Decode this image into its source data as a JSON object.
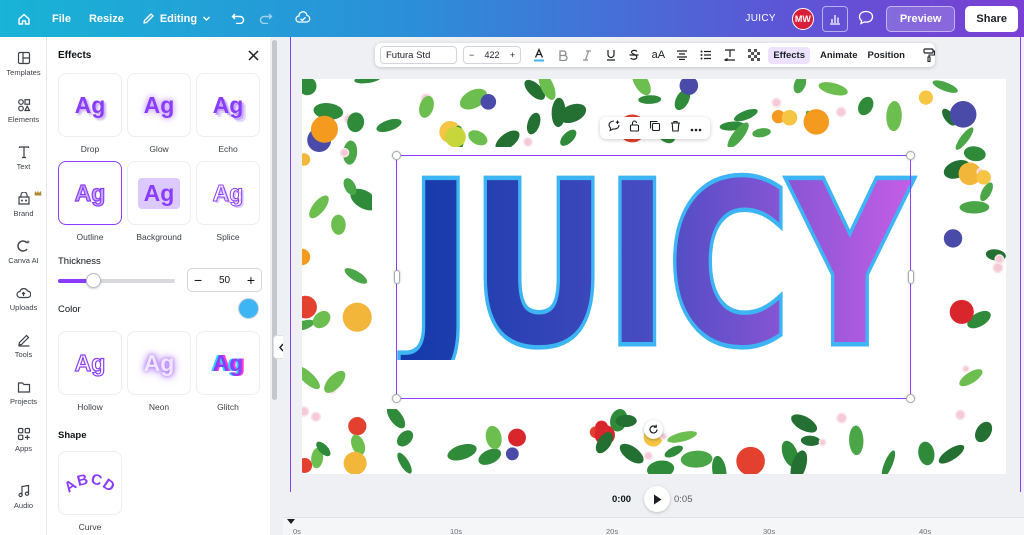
{
  "topbar": {
    "file_label": "File",
    "resize_label": "Resize",
    "editing_label": "Editing",
    "doc_title": "JUICY",
    "avatar_initials": "MW",
    "preview_label": "Preview",
    "share_label": "Share",
    "gradient_start": "#19b3d6",
    "gradient_end": "#7a3fd4"
  },
  "rail": {
    "items": [
      {
        "label": "Templates",
        "icon": "templates-icon"
      },
      {
        "label": "Elements",
        "icon": "elements-icon"
      },
      {
        "label": "Text",
        "icon": "text-icon"
      },
      {
        "label": "Brand",
        "icon": "brand-icon"
      },
      {
        "label": "Canva AI",
        "icon": "canva-ai-icon"
      },
      {
        "label": "Uploads",
        "icon": "uploads-icon"
      },
      {
        "label": "Tools",
        "icon": "tools-icon"
      },
      {
        "label": "Projects",
        "icon": "projects-icon"
      },
      {
        "label": "Apps",
        "icon": "apps-icon"
      },
      {
        "label": "Audio",
        "icon": "audio-icon"
      }
    ]
  },
  "panel": {
    "title": "Effects",
    "sample_text": "Ag",
    "styles": [
      {
        "label": "Drop"
      },
      {
        "label": "Glow"
      },
      {
        "label": "Echo"
      },
      {
        "label": "Outline",
        "selected": true
      },
      {
        "label": "Background"
      },
      {
        "label": "Splice"
      }
    ],
    "thickness_label": "Thickness",
    "thickness_value": "50",
    "thickness_fraction": 0.3,
    "color_label": "Color",
    "outline_color": "#3db5f5",
    "styles2": [
      {
        "label": "Hollow"
      },
      {
        "label": "Neon"
      },
      {
        "label": "Glitch"
      }
    ],
    "shape_label": "Shape",
    "shape_sample": "ABCD",
    "shape_item_label": "Curve"
  },
  "context_toolbar": {
    "font": "Futura Std",
    "font_size": "422",
    "minus": "−",
    "plus": "+",
    "case_label": "aA",
    "effects_label": "Effects",
    "animate_label": "Animate",
    "position_label": "Position"
  },
  "canvas": {
    "headline": "JUICY",
    "accent": "#8b3dff"
  },
  "playback": {
    "current_time": "0:00",
    "duration": "0:05",
    "ticks": [
      "0s",
      "10s",
      "20s",
      "30s",
      "40s"
    ]
  }
}
